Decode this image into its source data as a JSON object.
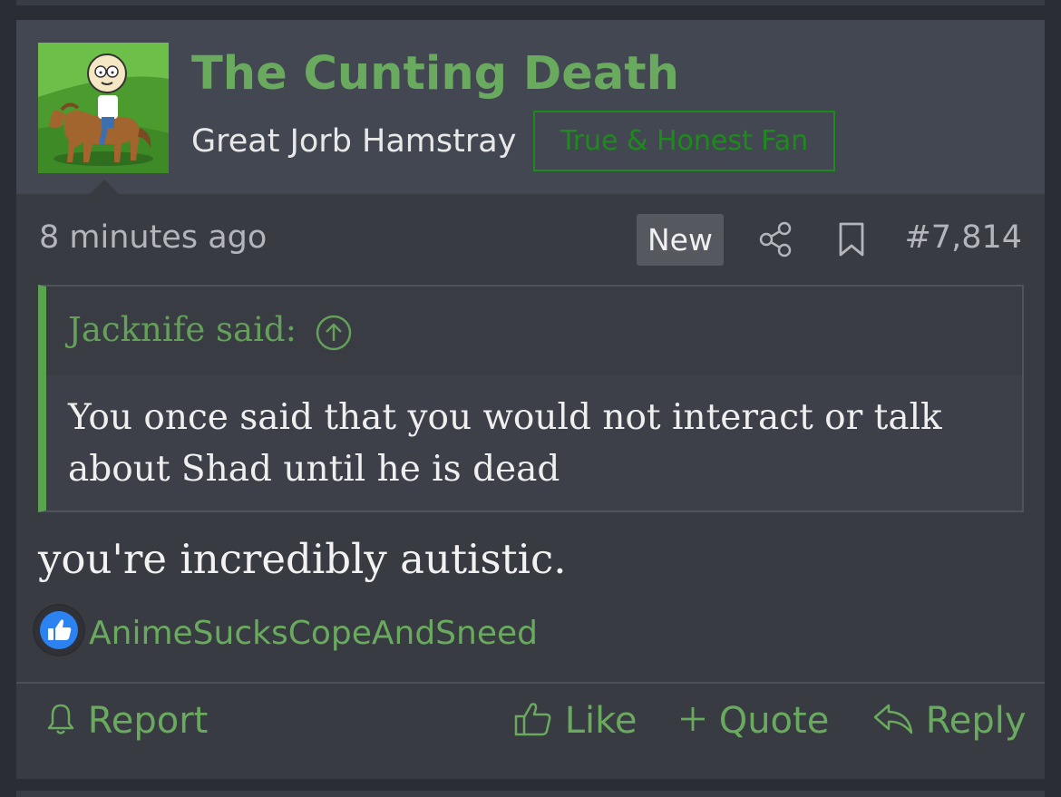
{
  "post": {
    "username": "The Cunting Death",
    "user_title": "Great Jorb Hamstray",
    "banner": "True & Honest Fan",
    "time": "8 minutes ago",
    "new_badge": "New",
    "post_number": "#7,814",
    "quote": {
      "author": "Jacknife said:",
      "text": "You once said that you would not interact or talk about Shad until he is dead"
    },
    "message": "you're incredibly autistic.",
    "reaction": {
      "icon": "like-icon",
      "users": "AnimeSucksCopeAndSneed"
    },
    "actions": {
      "report": "Report",
      "like": "Like",
      "quote": "Quote",
      "reply": "Reply"
    }
  },
  "colors": {
    "accent_green": "#6aaa5f",
    "banner_green": "#1e8a1e",
    "background": "#383b42",
    "header_background": "#434751"
  }
}
